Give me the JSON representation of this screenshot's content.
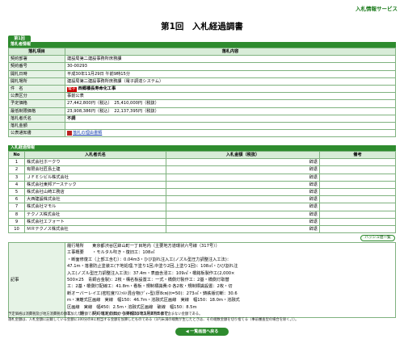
{
  "header": {
    "service_link": "入札情報サービス",
    "page_title": "第1回　入札経過調書"
  },
  "round_badge": "第1回",
  "bid_info": {
    "section_title": "落札者情報",
    "col_item": "落札項目",
    "col_content": "落札内容",
    "rows": [
      {
        "label": "契約部署",
        "value": "建設局第二建設事務所庶務課"
      },
      {
        "label": "契約番号",
        "value": "30-00293"
      },
      {
        "label": "開札日時",
        "value": "平成30年11月29日 午前9時15分"
      },
      {
        "label": "開札場所",
        "value": "建設局第二建設事務所庶務課（電子調達システム）"
      },
      {
        "label": "件　名",
        "value": "西郷橋長寿命化工事",
        "badge": "電子"
      },
      {
        "label": "公表区分",
        "value": "事前公表"
      },
      {
        "label": "予定価格",
        "value": "27,442,800円（税込）　25,410,000円（税抜）"
      },
      {
        "label": "最低制限価格",
        "value": "23,908,386円（税込）　22,137,395円（税抜）"
      },
      {
        "label": "落札者氏名",
        "value": "不調"
      },
      {
        "label": "落札金額",
        "value": ""
      },
      {
        "label": "公表通知書",
        "value": "落札の理由書類",
        "is_link": true
      }
    ]
  },
  "bidders": {
    "section_title": "入札経過情報",
    "col_no": "No",
    "col_name": "入札者氏名",
    "col_amount": "入札金額（税抜）",
    "col_note": "備考",
    "rows": [
      {
        "no": "1",
        "name": "株式会社ホークウ",
        "amount": "",
        "note": "辞退"
      },
      {
        "no": "2",
        "name": "有限会社匠島土建",
        "amount": "",
        "note": "辞退"
      },
      {
        "no": "3",
        "name": "ＪＦＥシビル株式会社",
        "amount": "",
        "note": "辞退"
      },
      {
        "no": "4",
        "name": "株式会社東邦アーステック",
        "amount": "",
        "note": "辞退"
      },
      {
        "no": "5",
        "name": "株式会社山崎工務店",
        "amount": "",
        "note": "辞退"
      },
      {
        "no": "6",
        "name": "大西建設株式会社",
        "amount": "",
        "note": "辞退"
      },
      {
        "no": "7",
        "name": "株式会社マモル",
        "amount": "",
        "note": "辞退"
      },
      {
        "no": "8",
        "name": "テクノス株式会社",
        "amount": "",
        "note": "辞退"
      },
      {
        "no": "9",
        "name": "株式会社エフォート",
        "amount": "",
        "note": "辞退"
      },
      {
        "no": "10",
        "name": "ＭＲテクノス株式会社",
        "amount": "",
        "note": "辞退"
      }
    ],
    "hyoshiki_button": "ハッシュ値一覧"
  },
  "remarks": {
    "label": "記事",
    "lines": [
      "履行場所　　東京都渋谷区鉢山町一丁目地内（主要地方道環状六号線（317号））",
      "工事概要　　・モルタル吹き・復旧工：108㎡",
      "・断面修復工（上部工含む）：0.04m3・ひび割れ注入工(ノズル型圧力調整注入工法)：",
      "47.1m・落書防止塗装工(下地処理,下塗り1回,中塗り2回,上塗り1回)：108㎡・ひび割れ注",
      "入工(ノズル型圧力調整注入工法)：37.4m・表面含浸工：109㎡・橋銘板製作工(2,000×",
      "500×25　青銅合金製)：2枚・構名板設置工：一式・橋側灯製作工：2基・橋側灯取替",
      "工：2基・橋側灯配線工：41.8m・看板・規制標識費:0 各2枚・規制標識設置：2枚・切",
      "断オーバーレイ工(密粒度ｱｽﾌｧﾙﾄ混合物(ﾃﾞｨｰ型(厚8㎝)(t=50)：273㎡・鋳鉄版切断：30.6",
      "m・凍離式区画線　実線　幅150：46.7m・溶融式区画線　実線　幅150：18.0m・溶融式",
      "区画線　実線　幅450：2.5m・溶融式区画線　破線　幅150：8.5m",
      "工　　期　　契約確定の日から平成31年3月27日まで"
    ]
  },
  "footnotes": [
    "予定価格は消費税及び地方消費税の額を加えた金額であり、入札金額は、消費税及び地方消費税の額を含まない金額である。",
    "落札金額は、入札金額に記載している金額に100分の8に相当する金額を加算したものである（1円未満の端数が生じたときは、その端数金額を切り捨てる（事前審査型の場合を除く。））。"
  ],
  "back_button": "◀ 一覧画面へ戻る",
  "colors": {
    "accent": "#2e8b2e",
    "header_bg": "#d8ecd8",
    "label_bg": "#e6f3e6",
    "badge_red": "#cc0000"
  }
}
